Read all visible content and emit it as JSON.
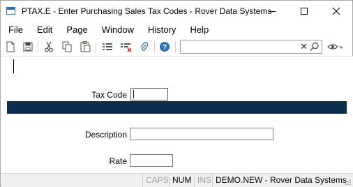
{
  "window": {
    "title": "PTAX.E - Enter Purchasing Sales Tax Codes - Rover Data Systems"
  },
  "menu": {
    "items": [
      "File",
      "Edit",
      "Page",
      "Window",
      "History",
      "Help"
    ]
  },
  "toolbar": {
    "icons": [
      "new-icon",
      "save-icon",
      "cut-icon",
      "copy-icon",
      "paste-icon",
      "list-icon",
      "delete-list-icon",
      "attach-icon",
      "help-icon"
    ],
    "search": {
      "value": "",
      "placeholder": "",
      "clear_glyph": "✕"
    }
  },
  "form": {
    "tax_code": {
      "label": "Tax Code",
      "value": ""
    },
    "description": {
      "label": "Description",
      "value": ""
    },
    "rate": {
      "label": "Rate",
      "value": ""
    }
  },
  "statusbar": {
    "caps": "CAPS",
    "num": "NUM",
    "ins": "INS",
    "account": "DEMO.NEW - Rover Data Systems"
  },
  "colors": {
    "band": "#0b2e4f",
    "accent_icon": "#2d6fb6"
  }
}
